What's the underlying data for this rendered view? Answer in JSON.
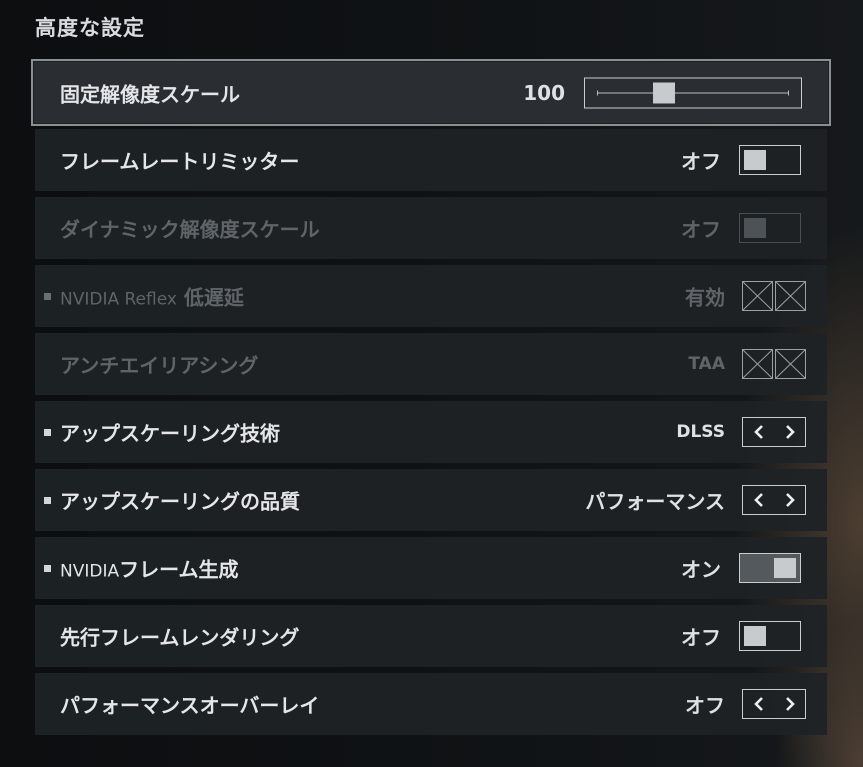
{
  "section_title": "高度な設定",
  "settings": [
    {
      "label": "固定解像度スケール",
      "value": "100",
      "control": "slider",
      "slider_level": 0.35
    },
    {
      "label": "フレームレートリミッター",
      "value": "オフ",
      "control": "toggle",
      "state": "off"
    },
    {
      "label": "ダイナミック解像度スケール",
      "value": "オフ",
      "control": "toggle",
      "state": "off",
      "disabled": true
    },
    {
      "label_ascii": "NVIDIA Reflex",
      "label": "低遅延",
      "value": "有効",
      "control": "locked",
      "bullet": true,
      "disabled": true
    },
    {
      "label": "アンチエイリアシング",
      "value": "TAA",
      "control": "locked",
      "disabled": true
    },
    {
      "label": "アップスケーリング技術",
      "value": "DLSS",
      "control": "arrows",
      "bullet": true
    },
    {
      "label": "アップスケーリングの品質",
      "value": "パフォーマンス",
      "control": "arrows",
      "bullet": true
    },
    {
      "label_ascii": "NVIDIA",
      "label": "フレーム生成",
      "value": "オン",
      "control": "toggle",
      "state": "on",
      "bullet": true
    },
    {
      "label": "先行フレームレンダリング",
      "value": "オフ",
      "control": "toggle",
      "state": "off"
    },
    {
      "label": "パフォーマンスオーバーレイ",
      "value": "オフ",
      "control": "arrows"
    }
  ],
  "icons": {
    "prev": "chevron-left-icon",
    "next": "chevron-right-icon",
    "locked": "crossed-box-icon"
  }
}
